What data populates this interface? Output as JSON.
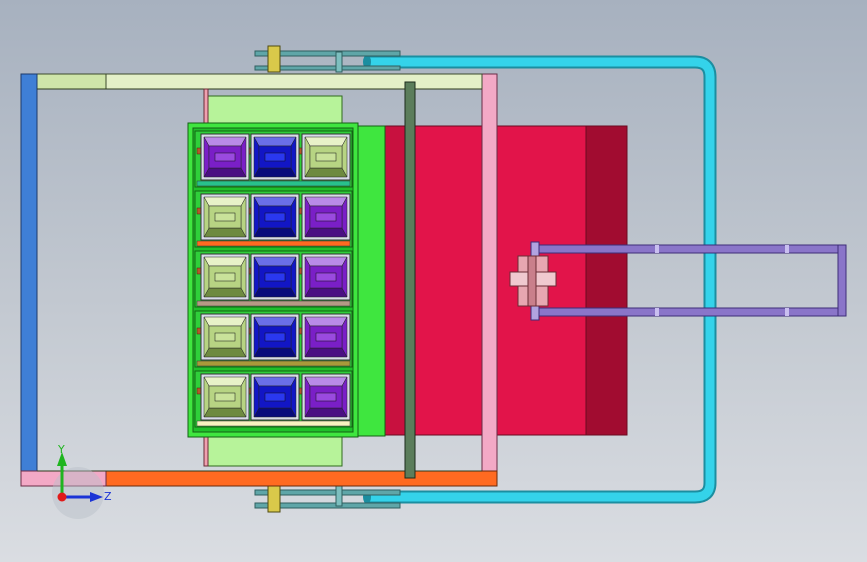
{
  "colors": {
    "background_top": "#a7b1bf",
    "background_bottom": "#dadde2",
    "frame_left": "#3f7fd6",
    "frame_top": "#cfe5a9",
    "frame_right": "#f3a9c6",
    "frame_bottom": "#ff6a21",
    "handle_tube": "#29c9e0",
    "body_red": "#e2144a",
    "body_red_dark": "#a10c30",
    "tray_green": "#3fe63f",
    "mount_light_green": "#b7f39a",
    "violet_rod": "#8a75c9",
    "mold_violet": "#7a1fc7",
    "mold_blue": "#1216c5",
    "mold_olive": "#b7d483",
    "axis_x": "#e01a1a",
    "axis_y": "#1fb51f",
    "axis_z": "#1a33d6"
  },
  "grid": {
    "rows": [
      {
        "stripe": "#28c28c",
        "cells": [
          "violet",
          "blue",
          "olive"
        ]
      },
      {
        "stripe": "#ff6a21",
        "cells": [
          "olive",
          "blue",
          "violet"
        ]
      },
      {
        "stripe": "#b59a85",
        "cells": [
          "olive",
          "blue",
          "violet"
        ]
      },
      {
        "stripe": "#a89a3a",
        "cells": [
          "olive",
          "blue",
          "violet"
        ]
      },
      {
        "stripe": "#f7f3c0",
        "cells": [
          "olive",
          "blue",
          "violet"
        ]
      }
    ]
  },
  "triad": {
    "y_label": "Y",
    "z_label": "Z"
  }
}
